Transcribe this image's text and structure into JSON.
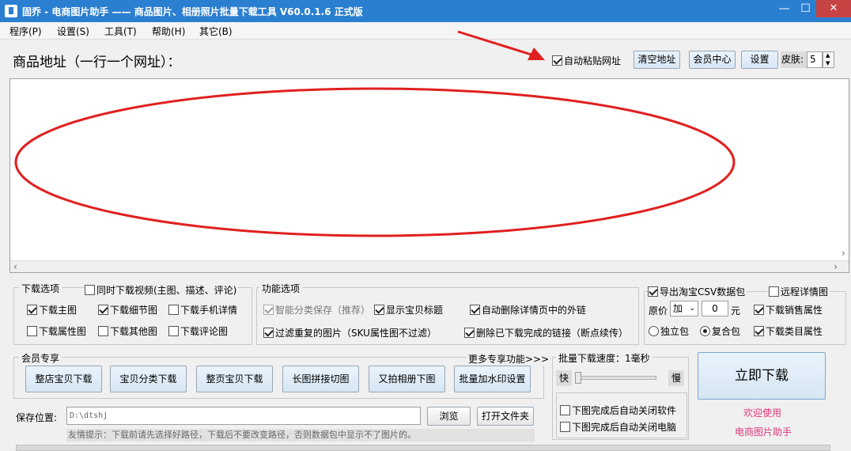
{
  "window": {
    "title": "固乔 - 电商图片助手 —— 商品图片、相册照片批量下载工具 V60.0.1.6 正式版",
    "minimize": "—",
    "maximize": "☐",
    "close": "✕"
  },
  "menu": [
    "程序(P)",
    "设置(S)",
    "工具(T)",
    "帮助(H)",
    "其它(B)"
  ],
  "url_label": "商品地址（一行一个网址）：",
  "top_controls": {
    "auto_paste": "自动粘贴网址",
    "auto_paste_checked": true,
    "clear_button": "清空地址",
    "member_center_button": "会员中心",
    "settings_button": "设置",
    "skin_label": "皮肤:",
    "skin_value": "5"
  },
  "download_options": {
    "title": "下载选项",
    "video_option": "同时下载视频(主图、描述、评论)",
    "items": [
      {
        "label": "下载主图",
        "checked": true
      },
      {
        "label": "下载细节图",
        "checked": true
      },
      {
        "label": "下载手机详情",
        "checked": false
      },
      {
        "label": "下载属性图",
        "checked": false
      },
      {
        "label": "下载其他图",
        "checked": false
      },
      {
        "label": "下载评论图",
        "checked": false
      }
    ]
  },
  "function_options": {
    "title": "功能选项",
    "items": [
      {
        "label": "智能分类保存（推荐）",
        "checked": true
      },
      {
        "label": "显示宝贝标题",
        "checked": true
      },
      {
        "label": "自动删除详情页中的外链",
        "checked": true
      },
      {
        "label": "过滤重复的图片（SKU属性图不过滤）",
        "checked": true
      },
      {
        "label": "删除已下载完成的链接（断点续传）",
        "checked": true
      }
    ]
  },
  "csv_options": {
    "export_csv": "导出淘宝CSV数据包",
    "remote_detail": "远程详情图",
    "price_label": "原价",
    "price_op": "加",
    "price_value": "0",
    "price_unit": "元",
    "sales_attr": "下载销售属性",
    "standalone": "独立包",
    "composite": "复合包",
    "category_attr": "下载类目属性"
  },
  "member": {
    "title": "会员专享",
    "more": "更多专享功能>>>",
    "buttons": [
      "整店宝贝下载",
      "宝贝分类下载",
      "整页宝贝下载",
      "长图拼接切图",
      "又拍相册下图",
      "批量加水印设置"
    ]
  },
  "speed": {
    "title": "批量下载速度：1毫秒",
    "fast": "快",
    "slow": "慢",
    "close_app": "下图完成后自动关闭软件",
    "shutdown": "下图完成后自动关闭电脑"
  },
  "download_now": "立即下载",
  "welcome": [
    "欢迎使用",
    "电商图片助手"
  ],
  "save": {
    "label": "保存位置:",
    "path": "D:\\dtshj",
    "browse": "浏览",
    "open_folder": "打开文件夹"
  },
  "hint": "友情提示：下载前请先选择好路径，下载后不要改变路径，否则数据包中显示不了图片的。"
}
